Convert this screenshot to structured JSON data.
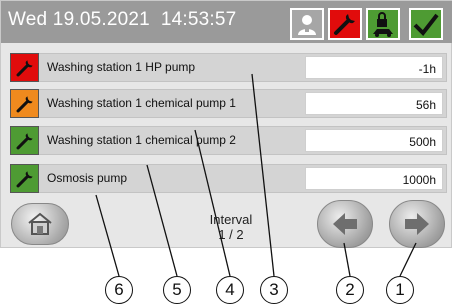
{
  "header": {
    "datetime": "Wed 19.05.2021  14:53:57",
    "buttons": [
      {
        "icon": "user-icon",
        "color": "#a6a6a6"
      },
      {
        "icon": "wrench-icon",
        "color": "#e10c0c"
      },
      {
        "icon": "lock-vehicle-icon",
        "color": "#4e9b33"
      },
      {
        "icon": "checkmark-icon",
        "color": "#4e9b33"
      }
    ]
  },
  "rows": [
    {
      "label": "Washing station 1 HP pump",
      "value": "-1h",
      "status_color": "#e10c0c"
    },
    {
      "label": "Washing station 1 chemical pump 1",
      "value": "56h",
      "status_color": "#ef8a1e"
    },
    {
      "label": "Washing station 1 chemical pump 2",
      "value": "500h",
      "status_color": "#4e9b33"
    },
    {
      "label": "Osmosis pump",
      "value": "1000h",
      "status_color": "#4e9b33"
    }
  ],
  "footer": {
    "interval_label": "Interval",
    "page": "1 / 2"
  },
  "callouts": [
    "6",
    "5",
    "4",
    "3",
    "2",
    "1"
  ]
}
